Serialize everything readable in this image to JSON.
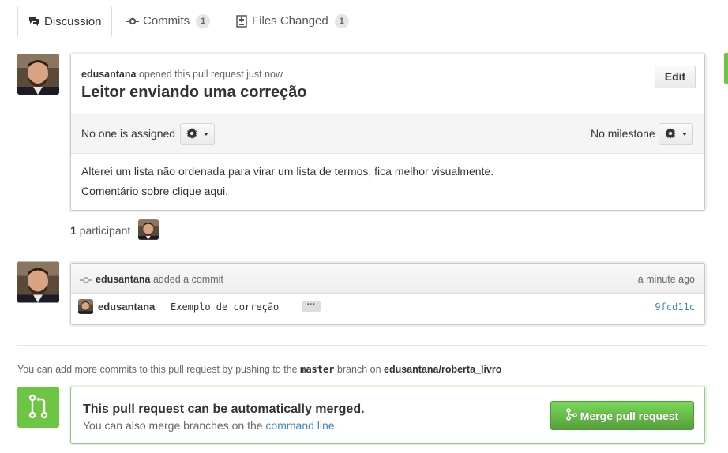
{
  "tabs": [
    {
      "label": "Discussion",
      "icon": "discussion-icon",
      "active": true
    },
    {
      "label": "Commits",
      "icon": "commit-icon",
      "count": "1"
    },
    {
      "label": "Files Changed",
      "icon": "diff-file-icon",
      "count": "1"
    }
  ],
  "pull_request": {
    "author": "edusantana",
    "opened_text": "opened this pull request just now",
    "title": "Leitor enviando uma correção",
    "edit_label": "Edit",
    "assignee_text": "No one is assigned",
    "milestone_text": "No milestone",
    "body_lines": [
      "Alterei um lista não ordenada para virar um lista de termos, fica melhor visualmente.",
      "Comentário sobre clique aqui."
    ]
  },
  "participants": {
    "count": "1",
    "label": "participant"
  },
  "commit_event": {
    "author": "edusantana",
    "action_text": "added a commit",
    "time": "a minute ago",
    "commit_author": "edusantana",
    "message": "Exemplo de correção",
    "ellipsis": "···",
    "sha": "9fcd11c"
  },
  "push_hint": {
    "prefix": "You can add more commits to this pull request by pushing to the",
    "branch": "master",
    "middle": "branch on",
    "repo": "edusantana/roberta_livro"
  },
  "merge": {
    "title": "This pull request can be automatically merged.",
    "sub_prefix": "You can also merge branches on the",
    "link": "command line",
    "sub_suffix": ".",
    "button_label": "Merge pull request"
  },
  "colors": {
    "merge_green": "#6cc644",
    "link_blue": "#4183c4"
  }
}
